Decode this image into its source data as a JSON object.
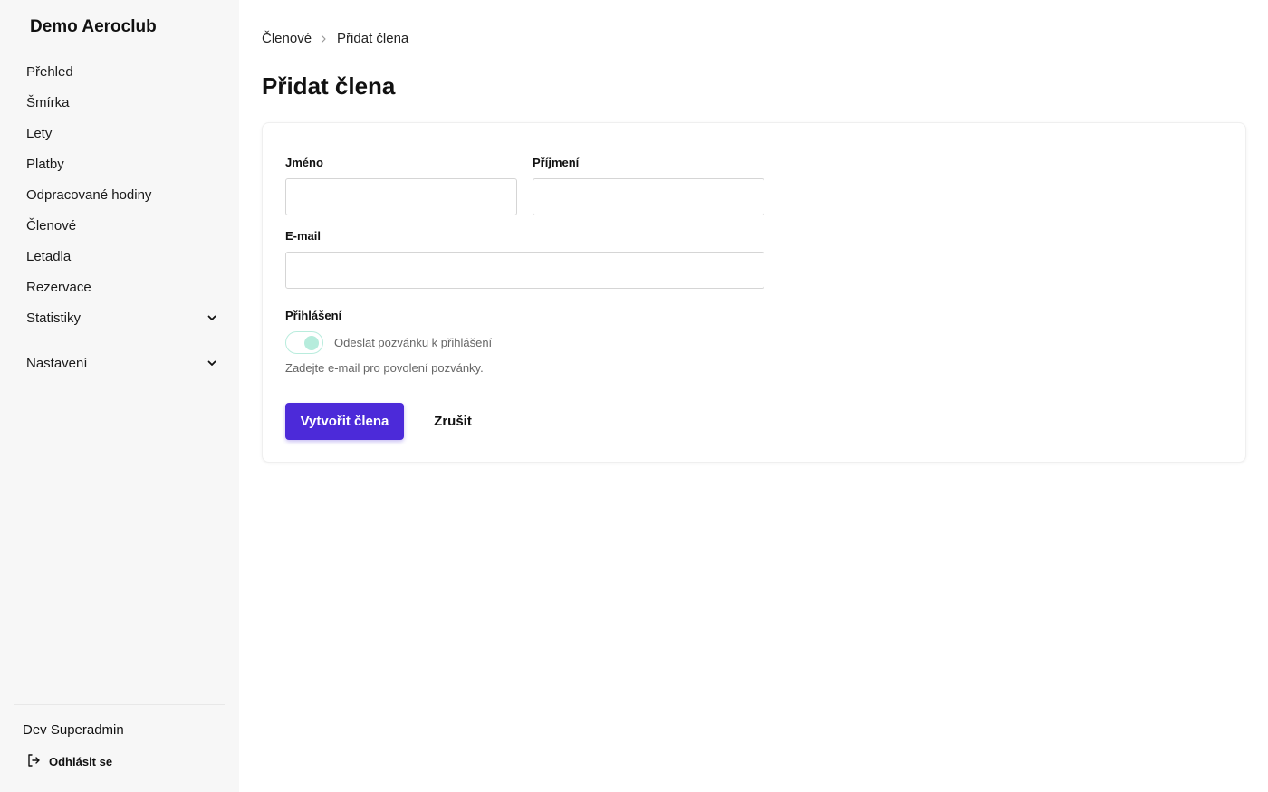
{
  "brand": "Demo Aeroclub",
  "nav": [
    {
      "label": "Přehled"
    },
    {
      "label": "Šmírka"
    },
    {
      "label": "Lety"
    },
    {
      "label": "Platby"
    },
    {
      "label": "Odpracované hodiny"
    },
    {
      "label": "Členové"
    },
    {
      "label": "Letadla"
    },
    {
      "label": "Rezervace"
    },
    {
      "label": "Statistiky",
      "icon": "chevron-down-icon"
    },
    {
      "label": "Nastavení",
      "icon": "chevron-down-icon"
    }
  ],
  "user": {
    "name": "Dev Superadmin",
    "logout_label": "Odhlásit se",
    "logout_icon": "logout-icon"
  },
  "breadcrumb": {
    "parent": "Členové",
    "current": "Přidat člena",
    "separator_icon": "chevron-right-icon"
  },
  "page_title": "Přidat člena",
  "form": {
    "first_name": {
      "label": "Jméno",
      "value": ""
    },
    "last_name": {
      "label": "Příjmení",
      "value": ""
    },
    "email": {
      "label": "E-mail",
      "value": ""
    },
    "login": {
      "label": "Přihlášení",
      "toggle_label": "Odeslat pozvánku k přihlášení",
      "toggle_state": "on-disabled",
      "hint": "Zadejte e-mail pro povolení pozvánky."
    },
    "submit_label": "Vytvořit člena",
    "cancel_label": "Zrušit"
  },
  "colors": {
    "primary": "#4c2ad9",
    "toggle": "#b6ecdc",
    "sidebar_bg": "#f7f7f7"
  }
}
